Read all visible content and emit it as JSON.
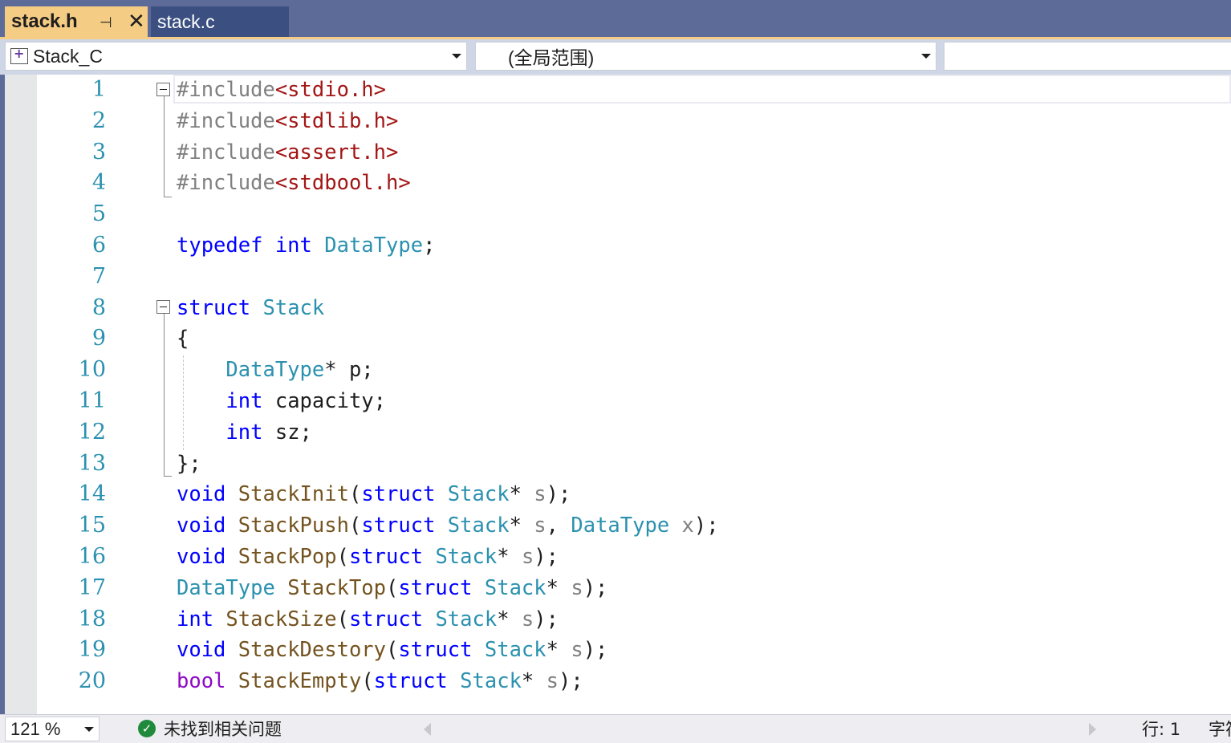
{
  "tabs": [
    {
      "label": "stack.h",
      "active": true
    },
    {
      "label": "stack.c",
      "active": false
    }
  ],
  "icons": {
    "pin": "pin-icon",
    "close": "close-icon",
    "project": "project-icon",
    "ok": "check-circle-icon"
  },
  "pin_glyph": "⊣",
  "close_glyph": "✕",
  "nav": {
    "project": "Stack_C",
    "scope": "(全局范围)",
    "member": ""
  },
  "editor": {
    "line_numbers": [
      "1",
      "2",
      "3",
      "4",
      "5",
      "6",
      "7",
      "8",
      "9",
      "10",
      "11",
      "12",
      "13",
      "14",
      "15",
      "16",
      "17",
      "18",
      "19",
      "20"
    ],
    "lines": [
      [
        {
          "c": "pp",
          "t": "#include"
        },
        {
          "c": "str",
          "t": "<stdio.h>"
        }
      ],
      [
        {
          "c": "pp",
          "t": "#include"
        },
        {
          "c": "str",
          "t": "<stdlib.h>"
        }
      ],
      [
        {
          "c": "pp",
          "t": "#include"
        },
        {
          "c": "str",
          "t": "<assert.h>"
        }
      ],
      [
        {
          "c": "pp",
          "t": "#include"
        },
        {
          "c": "str",
          "t": "<stdbool.h>"
        }
      ],
      [],
      [
        {
          "c": "kw",
          "t": "typedef"
        },
        {
          "c": "",
          "t": " "
        },
        {
          "c": "kw",
          "t": "int"
        },
        {
          "c": "",
          "t": " "
        },
        {
          "c": "ty",
          "t": "DataType"
        },
        {
          "c": "",
          "t": ";"
        }
      ],
      [],
      [
        {
          "c": "kw",
          "t": "struct"
        },
        {
          "c": "",
          "t": " "
        },
        {
          "c": "ty",
          "t": "Stack"
        }
      ],
      [
        {
          "c": "",
          "t": "{"
        }
      ],
      [
        {
          "c": "",
          "t": "    "
        },
        {
          "c": "ty",
          "t": "DataType"
        },
        {
          "c": "",
          "t": "* p;"
        }
      ],
      [
        {
          "c": "",
          "t": "    "
        },
        {
          "c": "kw",
          "t": "int"
        },
        {
          "c": "",
          "t": " capacity;"
        }
      ],
      [
        {
          "c": "",
          "t": "    "
        },
        {
          "c": "kw",
          "t": "int"
        },
        {
          "c": "",
          "t": " sz;"
        }
      ],
      [
        {
          "c": "",
          "t": "};"
        }
      ],
      [
        {
          "c": "kw",
          "t": "void"
        },
        {
          "c": "",
          "t": " "
        },
        {
          "c": "fn",
          "t": "StackInit"
        },
        {
          "c": "",
          "t": "("
        },
        {
          "c": "kw",
          "t": "struct"
        },
        {
          "c": "",
          "t": " "
        },
        {
          "c": "ty",
          "t": "Stack"
        },
        {
          "c": "",
          "t": "* "
        },
        {
          "c": "pu",
          "t": "s"
        },
        {
          "c": "",
          "t": ");"
        }
      ],
      [
        {
          "c": "kw",
          "t": "void"
        },
        {
          "c": "",
          "t": " "
        },
        {
          "c": "fn",
          "t": "StackPush"
        },
        {
          "c": "",
          "t": "("
        },
        {
          "c": "kw",
          "t": "struct"
        },
        {
          "c": "",
          "t": " "
        },
        {
          "c": "ty",
          "t": "Stack"
        },
        {
          "c": "",
          "t": "* "
        },
        {
          "c": "pu",
          "t": "s"
        },
        {
          "c": "",
          "t": ", "
        },
        {
          "c": "ty",
          "t": "DataType"
        },
        {
          "c": "",
          "t": " "
        },
        {
          "c": "pu",
          "t": "x"
        },
        {
          "c": "",
          "t": ");"
        }
      ],
      [
        {
          "c": "kw",
          "t": "void"
        },
        {
          "c": "",
          "t": " "
        },
        {
          "c": "fn",
          "t": "StackPop"
        },
        {
          "c": "",
          "t": "("
        },
        {
          "c": "kw",
          "t": "struct"
        },
        {
          "c": "",
          "t": " "
        },
        {
          "c": "ty",
          "t": "Stack"
        },
        {
          "c": "",
          "t": "* "
        },
        {
          "c": "pu",
          "t": "s"
        },
        {
          "c": "",
          "t": ");"
        }
      ],
      [
        {
          "c": "ty",
          "t": "DataType"
        },
        {
          "c": "",
          "t": " "
        },
        {
          "c": "fn",
          "t": "StackTop"
        },
        {
          "c": "",
          "t": "("
        },
        {
          "c": "kw",
          "t": "struct"
        },
        {
          "c": "",
          "t": " "
        },
        {
          "c": "ty",
          "t": "Stack"
        },
        {
          "c": "",
          "t": "* "
        },
        {
          "c": "pu",
          "t": "s"
        },
        {
          "c": "",
          "t": ");"
        }
      ],
      [
        {
          "c": "kw",
          "t": "int"
        },
        {
          "c": "",
          "t": " "
        },
        {
          "c": "fn",
          "t": "StackSize"
        },
        {
          "c": "",
          "t": "("
        },
        {
          "c": "kw",
          "t": "struct"
        },
        {
          "c": "",
          "t": " "
        },
        {
          "c": "ty",
          "t": "Stack"
        },
        {
          "c": "",
          "t": "* "
        },
        {
          "c": "pu",
          "t": "s"
        },
        {
          "c": "",
          "t": ");"
        }
      ],
      [
        {
          "c": "kw",
          "t": "void"
        },
        {
          "c": "",
          "t": " "
        },
        {
          "c": "fn",
          "t": "StackDestory"
        },
        {
          "c": "",
          "t": "("
        },
        {
          "c": "kw",
          "t": "struct"
        },
        {
          "c": "",
          "t": " "
        },
        {
          "c": "ty",
          "t": "Stack"
        },
        {
          "c": "",
          "t": "* "
        },
        {
          "c": "pu",
          "t": "s"
        },
        {
          "c": "",
          "t": ");"
        }
      ],
      [
        {
          "c": "pl",
          "t": "bool"
        },
        {
          "c": "",
          "t": " "
        },
        {
          "c": "fn",
          "t": "StackEmpty"
        },
        {
          "c": "",
          "t": "("
        },
        {
          "c": "kw",
          "t": "struct"
        },
        {
          "c": "",
          "t": " "
        },
        {
          "c": "ty",
          "t": "Stack"
        },
        {
          "c": "",
          "t": "* "
        },
        {
          "c": "pu",
          "t": "s"
        },
        {
          "c": "",
          "t": ");"
        }
      ]
    ]
  },
  "status": {
    "zoom": "121 %",
    "issues": "未找到相关问题",
    "line": "行: 1",
    "col_label": "字符"
  },
  "colors": {
    "tab_active": "#f5cc84",
    "tab_inactive": "#3b4f81",
    "frame": "#5d6b99",
    "keyword": "#0000ff",
    "type": "#2b91af",
    "string": "#a31515",
    "function": "#74531f",
    "line_number": "#2b91af"
  }
}
